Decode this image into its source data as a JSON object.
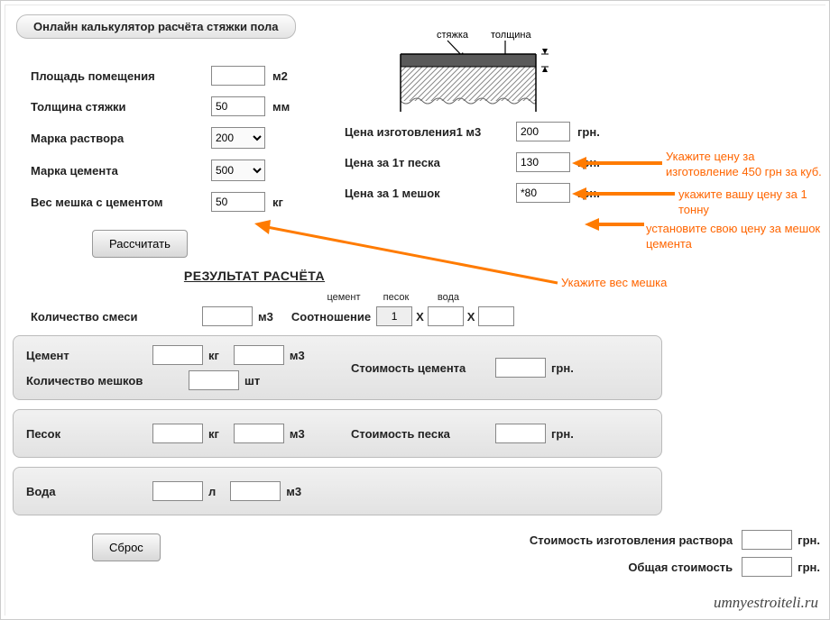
{
  "title": "Онлайн калькулятор расчёта стяжки пола",
  "diagram": {
    "label_screed": "стяжка",
    "label_thickness": "толщина"
  },
  "inputs": {
    "area_label": "Площадь помещения",
    "area_value": "",
    "area_unit": "м2",
    "thickness_label": "Толщина стяжки",
    "thickness_value": "50",
    "thickness_unit": "мм",
    "mortar_grade_label": "Марка раствора",
    "mortar_grade_value": "200",
    "cement_grade_label": "Марка цемента",
    "cement_grade_value": "500",
    "bag_weight_label": "Вес мешка с цементом",
    "bag_weight_value": "50",
    "bag_weight_unit": "кг",
    "price_m3_label": "Цена изготовления1 м3",
    "price_m3_value": "200",
    "price_m3_unit": "грн.",
    "price_sand_label": "Цена за 1т песка",
    "price_sand_value": "130",
    "price_sand_unit": "грн.",
    "price_bag_label": "Цена за 1 мешок",
    "price_bag_value": "*80",
    "price_bag_unit": "грн."
  },
  "buttons": {
    "calculate": "Рассчитать",
    "reset": "Сброс"
  },
  "result_title": "РЕЗУЛЬТАТ РАСЧЁТА",
  "mix": {
    "qty_label": "Количество смеси",
    "qty_unit": "м3",
    "ratio_label": "Соотношение",
    "ratio_headers": {
      "cement": "цемент",
      "sand": "песок",
      "water": "вода"
    },
    "ratio_cement": "1",
    "ratio_x": "X"
  },
  "results": {
    "cement_label": "Цемент",
    "kg": "кг",
    "m3": "м3",
    "pcs": "шт",
    "l": "л",
    "bags_label": "Количество мешков",
    "cement_cost_label": "Стоимость цемента",
    "grn": "грн.",
    "sand_label": "Песок",
    "sand_cost_label": "Стоимость песка",
    "water_label": "Вода",
    "total_make_label": "Стоимость изготовления раствора",
    "total_label": "Общая стоимость"
  },
  "annotations": {
    "a1": "Укажите цену за изготовление 450 грн за куб.",
    "a2": "укажите вашу цену за 1 тонну",
    "a3": "установите свою цену за мешок цемента",
    "a4": "Укажите вес мешка"
  },
  "watermark": "umnyestroiteli.ru"
}
